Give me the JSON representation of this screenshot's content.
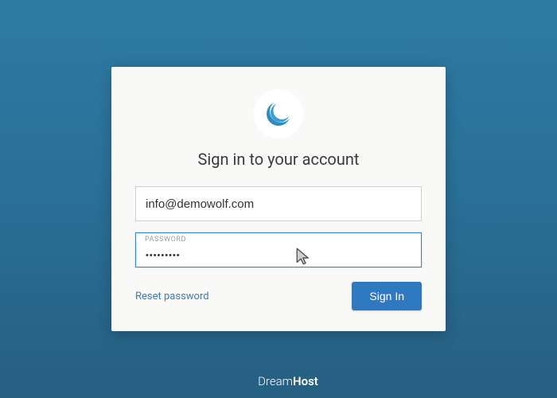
{
  "heading": "Sign in to your account",
  "email": {
    "value": "info@demowolf.com"
  },
  "password": {
    "label": "PASSWORD",
    "value": "•••••••••"
  },
  "reset_link": "Reset password",
  "signin_button": "Sign In",
  "brand": {
    "name_light": "Dream",
    "name_bold": "Host"
  },
  "colors": {
    "accent": "#2f78c2",
    "link": "#3b7db6"
  }
}
